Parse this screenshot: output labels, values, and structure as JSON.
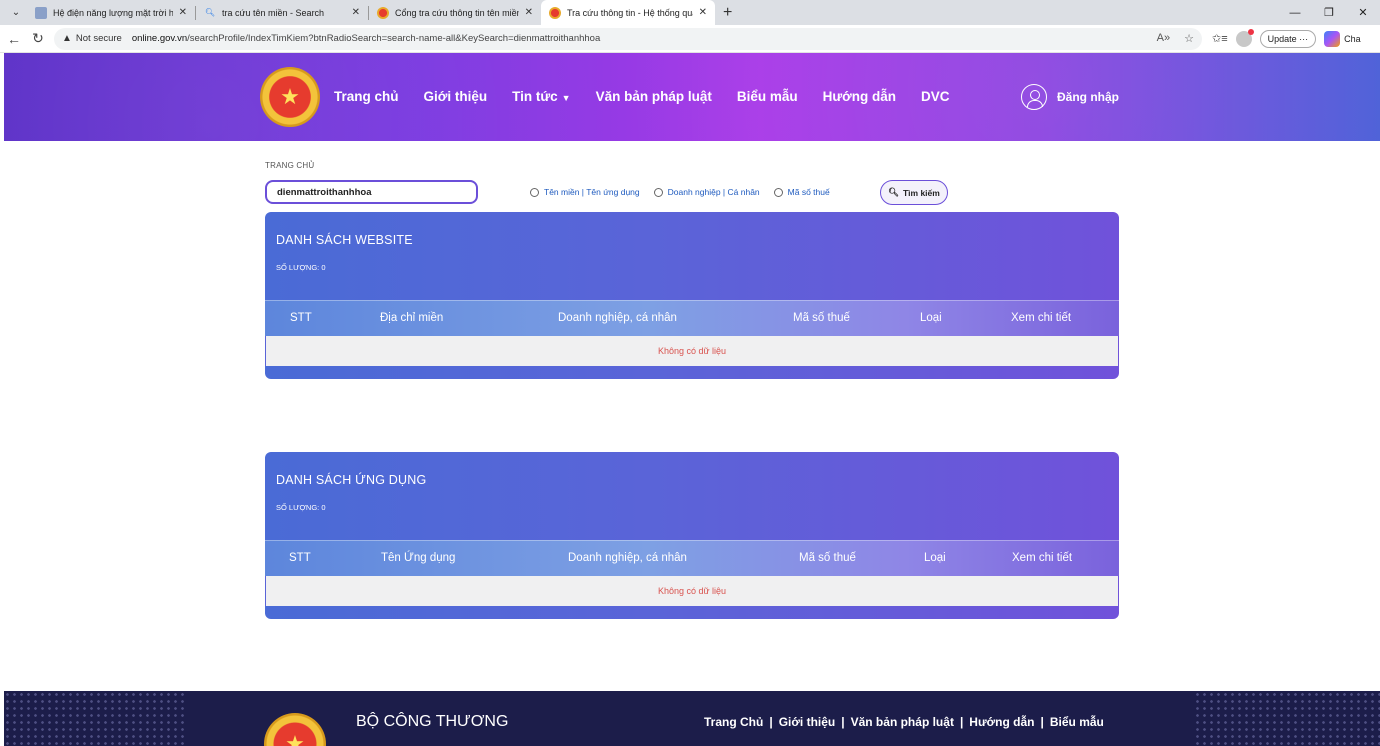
{
  "browser": {
    "tabs": [
      {
        "title": "Hệ điện năng lượng mặt trời hóa",
        "icon": "image-icon",
        "active": false
      },
      {
        "title": "tra cứu tên miền - Search",
        "icon": "search-icon",
        "active": false
      },
      {
        "title": "Cổng tra cứu thông tin tên miền",
        "icon": "emblem-icon",
        "active": false
      },
      {
        "title": "Tra cứu thông tin - Hệ thống quả",
        "icon": "emblem-icon",
        "active": true
      }
    ],
    "not_secure": "Not secure",
    "url_host": "online.gov.vn",
    "url_path": "/searchProfile/IndexTimKiem?btnRadioSearch=search-name-all&KeySearch=dienmattroithanhhoa",
    "update_label": "Update",
    "copilot_label": "Cha"
  },
  "header": {
    "nav": [
      "Trang chủ",
      "Giới thiệu",
      "Tin tức",
      "Văn bản pháp luật",
      "Biểu mẫu",
      "Hướng dẫn",
      "DVC"
    ],
    "login_label": "Đăng nhập"
  },
  "search": {
    "breadcrumb": "TRANG CHỦ",
    "query": "dienmattroithanhhoa",
    "radio_options": [
      "Tên miền | Tên ứng dụng",
      "Doanh nghiệp | Cá nhân",
      "Mã số thuế"
    ],
    "button_label": "Tìm kiếm"
  },
  "website_list": {
    "title": "DANH SÁCH WEBSITE",
    "count_label": "SỐ LƯỢNG: 0",
    "columns": [
      "STT",
      "Địa chỉ miền",
      "Doanh nghiệp, cá nhân",
      "Mã số thuế",
      "Loại",
      "Xem chi tiết"
    ],
    "empty_text": "Không có dữ liệu"
  },
  "app_list": {
    "title": "DANH SÁCH ỨNG DỤNG",
    "count_label": "SỐ LƯỢNG: 0",
    "columns": [
      "STT",
      "Tên Ứng dụng",
      "Doanh nghiệp, cá nhân",
      "Mã số thuế",
      "Loại",
      "Xem chi tiết"
    ],
    "empty_text": "Không có dữ liệu"
  },
  "footer": {
    "org": "BỘ CÔNG THƯƠNG",
    "links": [
      "Trang Chủ",
      "Giới thiệu",
      "Văn bản pháp luật",
      "Hướng dẫn",
      "Biểu mẫu"
    ]
  }
}
